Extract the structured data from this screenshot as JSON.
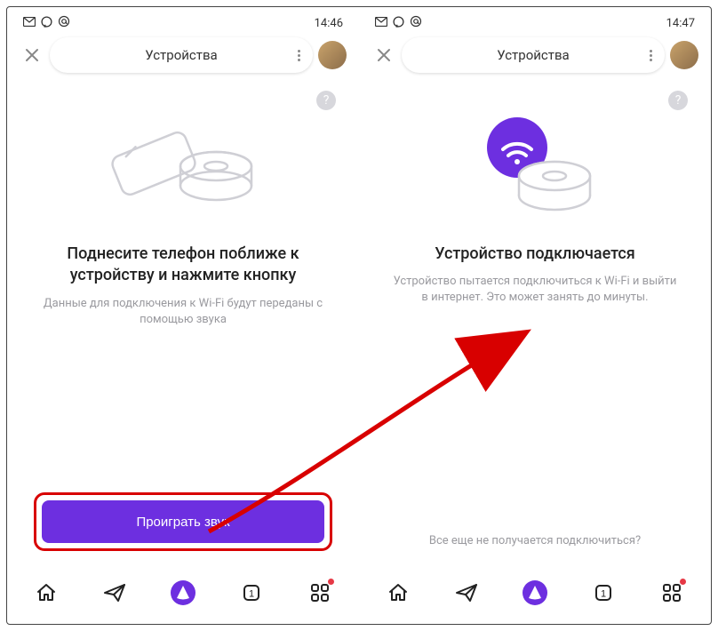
{
  "screens": {
    "left": {
      "status_time": "14:46",
      "search_title": "Устройства",
      "help_symbol": "?",
      "heading": "Поднесите телефон поближе к устройству и нажмите кнопку",
      "subtext": "Данные для подключения к Wi-Fi будут переданы с помощью звука",
      "primary_button": "Проиграть звук"
    },
    "right": {
      "status_time": "14:47",
      "search_title": "Устройства",
      "help_symbol": "?",
      "heading": "Устройство подключается",
      "subtext": "Устройство пытается подключиться к Wi-Fi и выйти в интернет. Это может занять до минуты.",
      "help_link": "Все еще не получается подключиться?"
    }
  },
  "bottom_nav": [
    "home",
    "send",
    "alice",
    "tabs",
    "apps"
  ],
  "colors": {
    "accent": "#6d2fe0",
    "annotation": "#d80000",
    "muted": "#9a9a9f"
  }
}
